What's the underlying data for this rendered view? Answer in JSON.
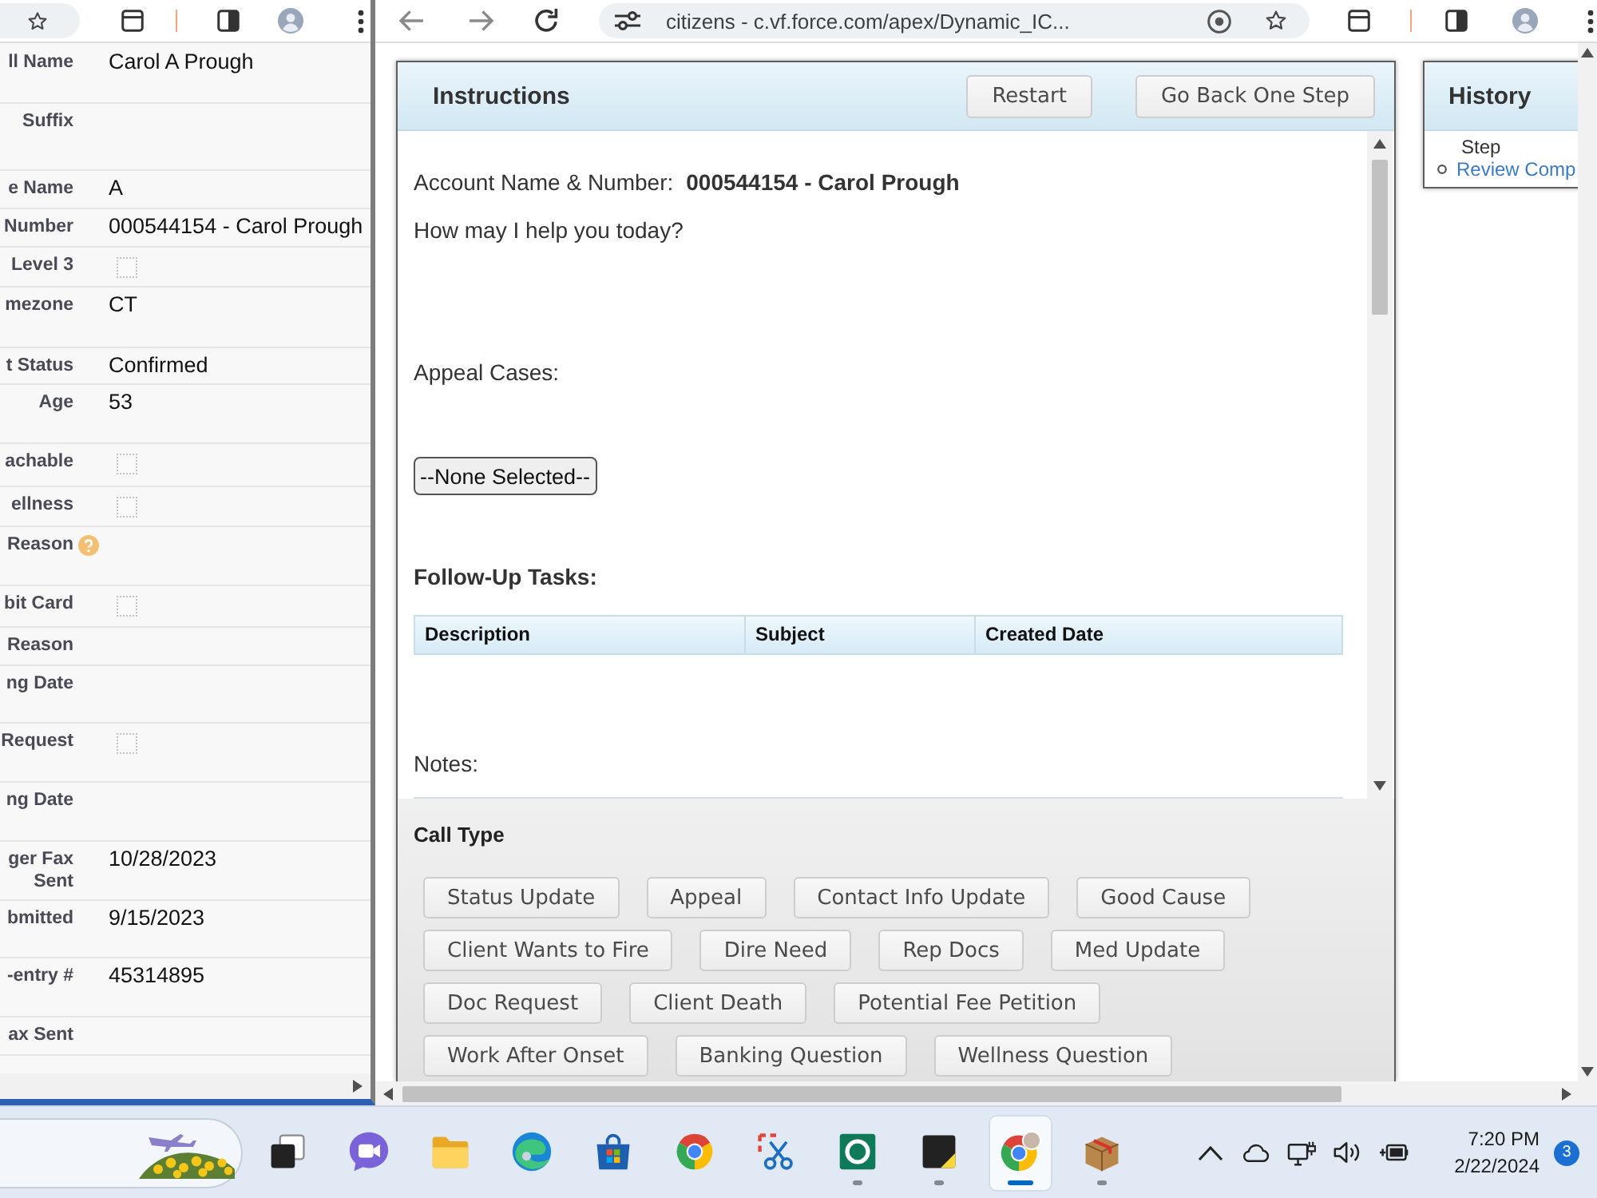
{
  "left_window": {
    "rows": [
      {
        "label": "ll Name",
        "kind": "text",
        "value": "Carol A Prough"
      },
      {
        "label": "Suffix",
        "kind": "text"
      },
      {
        "label": "e Name",
        "kind": "text",
        "value": "A"
      },
      {
        "label": "Number",
        "kind": "text",
        "value": "000544154 - Carol Prough"
      },
      {
        "label": "Level 3",
        "kind": "checkbox",
        "checked": false
      },
      {
        "label": "mezone",
        "kind": "text",
        "value": "CT"
      },
      {
        "label": "t Status",
        "kind": "text",
        "value": "Confirmed"
      },
      {
        "label": "Age",
        "kind": "text",
        "value": "53"
      },
      {
        "label": "achable",
        "kind": "checkbox",
        "checked": false
      },
      {
        "label": "ellness",
        "kind": "checkbox",
        "checked": false
      },
      {
        "label": "Reason",
        "kind": "help"
      },
      {
        "label": "bit Card",
        "kind": "checkbox",
        "checked": false
      },
      {
        "label": "Reason",
        "kind": "text"
      },
      {
        "label": "ng Date",
        "kind": "text"
      },
      {
        "label": "Request",
        "kind": "checkbox",
        "checked": false
      },
      {
        "label": "ng Date",
        "kind": "text"
      },
      {
        "label": "ger Fax Sent",
        "kind": "text",
        "value": "10/28/2023"
      },
      {
        "label": "bmitted",
        "kind": "text",
        "value": "9/15/2023"
      },
      {
        "label": "-entry #",
        "kind": "text",
        "value": "45314895"
      },
      {
        "label": "ax Sent",
        "kind": "text"
      }
    ]
  },
  "browser": {
    "address": "citizens - c.vf.force.com/apex/Dynamic_IC..."
  },
  "instructions": {
    "title": "Instructions",
    "buttons": [
      "Restart",
      "Go Back One Step"
    ],
    "account_label": "Account Name & Number:",
    "account_value": "000544154 - Carol Prough",
    "question": "How may I help you today?",
    "appeal_label": "Appeal Cases:",
    "appeal_select": "--None Selected--",
    "tasks_title": "Follow-Up Tasks:",
    "task_columns": [
      "Description",
      "Subject",
      "Created Date"
    ],
    "notes_label": "Notes:"
  },
  "call_type": {
    "title": "Call Type",
    "rows": [
      [
        "Status Update",
        "Appeal",
        "Contact Info Update",
        "Good Cause"
      ],
      [
        "Client Wants to Fire",
        "Dire Need",
        "Rep Docs",
        "Med Update"
      ],
      [
        "Doc Request",
        "Client Death",
        "Potential Fee Petition"
      ],
      [
        "Work After Onset",
        "Banking Question",
        "Wellness Question"
      ]
    ]
  },
  "history": {
    "title": "History",
    "step_label": "Step",
    "steps": [
      "Review Comp"
    ]
  },
  "taskbar": {
    "apps": [
      {
        "kind": "task-view",
        "running": false,
        "selected": false
      },
      {
        "kind": "video-call",
        "running": false,
        "selected": false
      },
      {
        "kind": "folder",
        "running": false,
        "selected": false
      },
      {
        "kind": "swirl-browser",
        "running": false,
        "selected": false
      },
      {
        "kind": "store",
        "running": false,
        "selected": false
      },
      {
        "kind": "round-browser",
        "running": false,
        "selected": false
      },
      {
        "kind": "snipping",
        "running": false,
        "selected": false
      },
      {
        "kind": "ring-app",
        "running": true,
        "selected": false
      },
      {
        "kind": "note",
        "running": true,
        "selected": false
      },
      {
        "kind": "round-browser-profile",
        "running": true,
        "selected": true
      },
      {
        "kind": "package",
        "running": true,
        "selected": false
      }
    ],
    "time": "7:20 PM",
    "date": "2/22/2024",
    "notifications": "3"
  }
}
